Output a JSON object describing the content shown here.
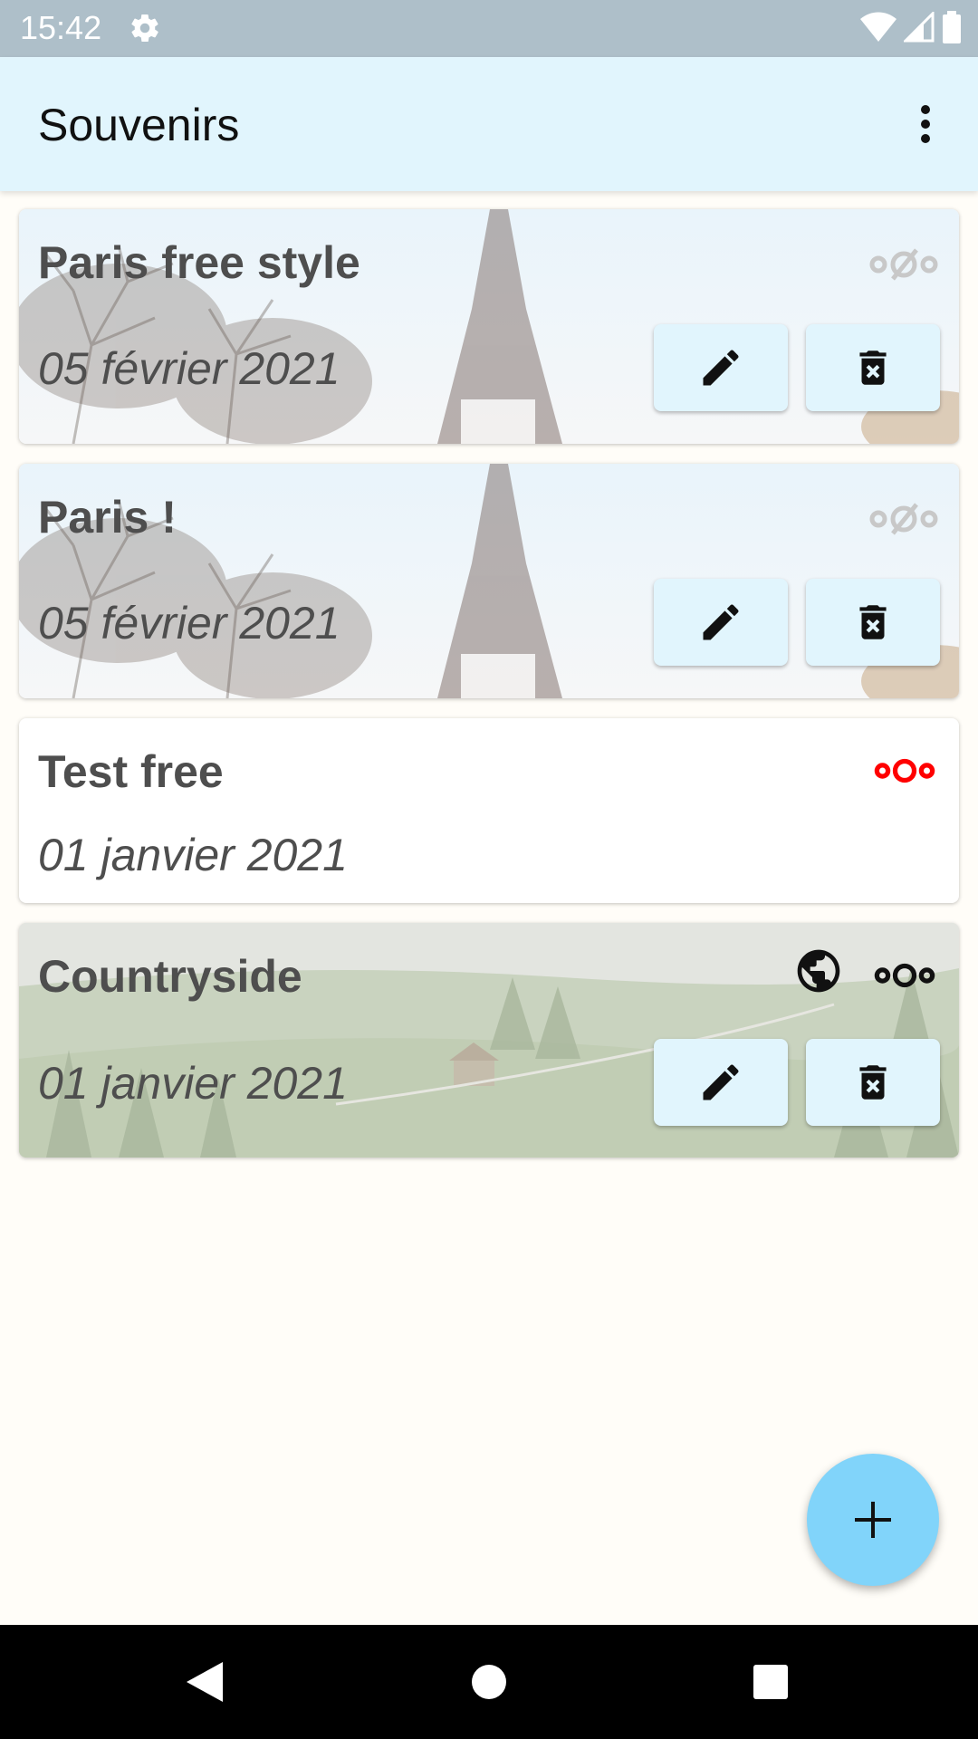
{
  "status_bar": {
    "time": "15:42",
    "icons": [
      "gear-icon",
      "wifi-icon",
      "signal-icon",
      "battery-icon"
    ]
  },
  "app_bar": {
    "title": "Souvenirs",
    "menu_icon": "more-vert-icon"
  },
  "cards": [
    {
      "title": "Paris free style",
      "date": "05 février 2021",
      "background": "eiffel-tower-photo",
      "sync_icon": "nextcloud-off-icon",
      "actions": [
        "edit-icon",
        "delete-icon"
      ]
    },
    {
      "title": "Paris !",
      "date": "05 février 2021",
      "background": "eiffel-tower-photo",
      "sync_icon": "nextcloud-off-icon",
      "actions": [
        "edit-icon",
        "delete-icon"
      ]
    },
    {
      "title": "Test free",
      "date": "01 janvier 2021",
      "background": "none",
      "sync_icon": "nextcloud-icon",
      "sync_color": "#ff0000"
    },
    {
      "title": "Countryside",
      "date": "01 janvier 2021",
      "background": "countryside-photo",
      "extra_icon": "globe-icon",
      "sync_icon": "nextcloud-icon",
      "actions": [
        "edit-icon",
        "delete-icon"
      ]
    }
  ],
  "fab": {
    "icon": "plus-icon"
  },
  "colors": {
    "app_bar": "#e1f5fd",
    "fab": "#81d4fa",
    "button": "#e1f5fd",
    "status_bar": "#aebfc9",
    "sync_active": "#ff0000"
  }
}
